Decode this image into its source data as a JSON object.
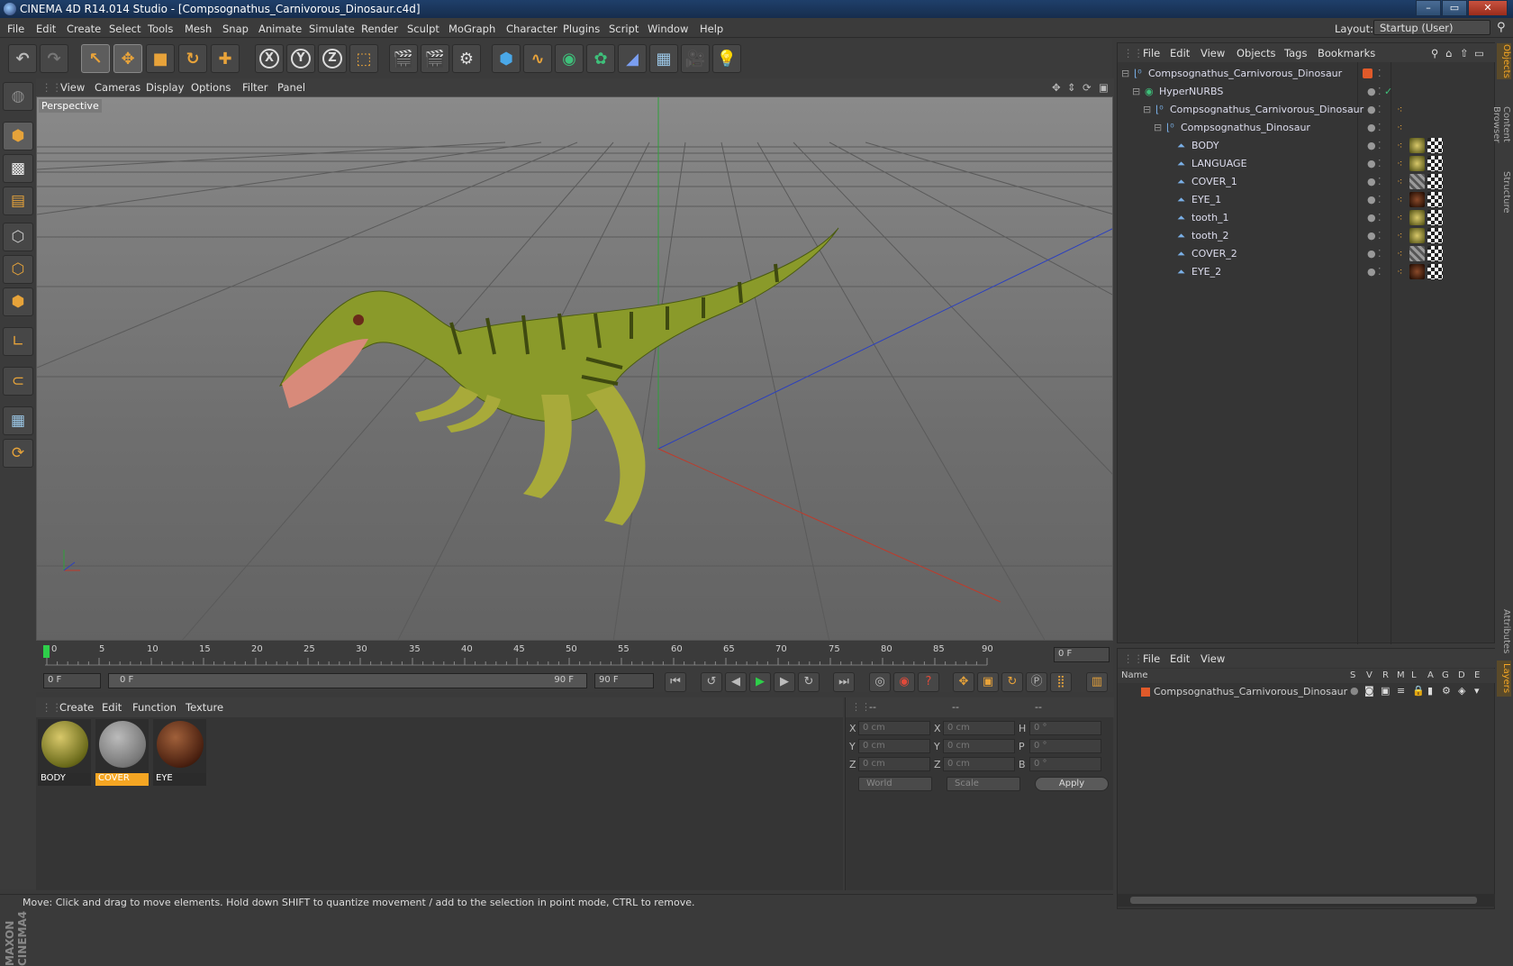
{
  "window": {
    "title": "CINEMA 4D R14.014 Studio - [Compsognathus_Carnivorous_Dinosaur.c4d]",
    "min": "–",
    "max": "▭",
    "close": "✕"
  },
  "menubar": {
    "items": [
      "File",
      "Edit",
      "Create",
      "Select",
      "Tools",
      "Mesh",
      "Snap",
      "Animate",
      "Simulate",
      "Render",
      "Sculpt",
      "MoGraph",
      "Character",
      "Plugins",
      "Script",
      "Window",
      "Help"
    ],
    "layout_label": "Layout:",
    "layout_value": "Startup (User)"
  },
  "toolbar": {
    "x_label": "X",
    "y_label": "Y",
    "z_label": "Z"
  },
  "viewport": {
    "menu": [
      "View",
      "Cameras",
      "Display",
      "Options",
      "Filter",
      "Panel"
    ],
    "label": "Perspective"
  },
  "timeline": {
    "ticks": [
      "0",
      "5",
      "10",
      "15",
      "20",
      "25",
      "30",
      "35",
      "40",
      "45",
      "50",
      "55",
      "60",
      "65",
      "70",
      "75",
      "80",
      "85",
      "90"
    ],
    "current_frame": "0 F",
    "start_frame": "0 F",
    "range_start": "0 F",
    "range_end": "90 F",
    "end_frame": "90 F"
  },
  "materials": {
    "menu": [
      "Create",
      "Edit",
      "Function",
      "Texture"
    ],
    "items": [
      {
        "name": "BODY"
      },
      {
        "name": "COVER"
      },
      {
        "name": "EYE"
      }
    ]
  },
  "coordinates": {
    "header": [
      "--",
      "--",
      "--"
    ],
    "rows": [
      {
        "l1": "X",
        "v1": "0 cm",
        "l2": "X",
        "v2": "0 cm",
        "l3": "H",
        "v3": "0 °"
      },
      {
        "l1": "Y",
        "v1": "0 cm",
        "l2": "Y",
        "v2": "0 cm",
        "l3": "P",
        "v3": "0 °"
      },
      {
        "l1": "Z",
        "v1": "0 cm",
        "l2": "Z",
        "v2": "0 cm",
        "l3": "B",
        "v3": "0 °"
      }
    ],
    "world": "World",
    "scale": "Scale",
    "apply": "Apply"
  },
  "objects": {
    "menu": [
      "File",
      "Edit",
      "View",
      "Objects",
      "Tags",
      "Bookmarks"
    ],
    "tree": [
      {
        "name": "Compsognathus_Carnivorous_Dinosaur",
        "indent": 0
      },
      {
        "name": "HyperNURBS",
        "indent": 1
      },
      {
        "name": "Compsognathus_Carnivorous_Dinosaur",
        "indent": 2
      },
      {
        "name": "Compsognathus_Dinosaur",
        "indent": 3
      },
      {
        "name": "BODY",
        "indent": 4
      },
      {
        "name": "LANGUAGE",
        "indent": 4
      },
      {
        "name": "COVER_1",
        "indent": 4
      },
      {
        "name": "EYE_1",
        "indent": 4
      },
      {
        "name": "tooth_1",
        "indent": 4
      },
      {
        "name": "tooth_2",
        "indent": 4
      },
      {
        "name": "COVER_2",
        "indent": 4
      },
      {
        "name": "EYE_2",
        "indent": 4
      }
    ]
  },
  "layers": {
    "menu": [
      "File",
      "Edit",
      "View"
    ],
    "columns": [
      "Name",
      "S",
      "V",
      "R",
      "M",
      "L",
      "A",
      "G",
      "D",
      "E"
    ],
    "row": "Compsognathus_Carnivorous_Dinosaur"
  },
  "sidetabs": [
    "Objects",
    "Content Browser",
    "Structure",
    "Attributes",
    "Layers"
  ],
  "status": "Move: Click and drag to move elements. Hold down SHIFT to quantize movement / add to the selection in point mode, CTRL to remove.",
  "colors": {
    "accent": "#e8a33a",
    "selection": "#f5a623",
    "panel": "#353535"
  }
}
